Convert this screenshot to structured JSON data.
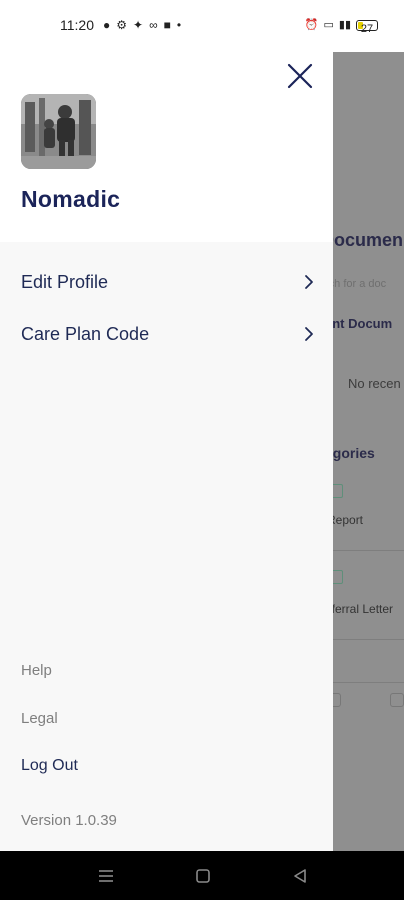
{
  "status_bar": {
    "time": "11:20",
    "battery": "27"
  },
  "drawer": {
    "app_name": "Nomadic",
    "menu": [
      {
        "label": "Edit Profile"
      },
      {
        "label": "Care Plan Code"
      }
    ],
    "footer": {
      "help": "Help",
      "legal": "Legal",
      "logout": "Log Out",
      "version": "Version 1.0.39"
    }
  },
  "background_page": {
    "title": "Documen",
    "search_placeholder": "rch for a doc",
    "recent_heading": "ent Docum",
    "no_recent": "No recen",
    "categories_heading": "egories",
    "categories": [
      "Report",
      "eferral Letter"
    ]
  },
  "colors": {
    "brand_navy": "#1b2459",
    "drawer_bg": "#f8f8f8",
    "scrim": "#8f8f8f",
    "muted_text": "#7f7f7f"
  },
  "icons": {
    "close": "close-icon",
    "chevron": "chevron-right-icon",
    "nav_menu": "menu-icon",
    "nav_home": "home-square-icon",
    "nav_back": "back-triangle-icon"
  }
}
